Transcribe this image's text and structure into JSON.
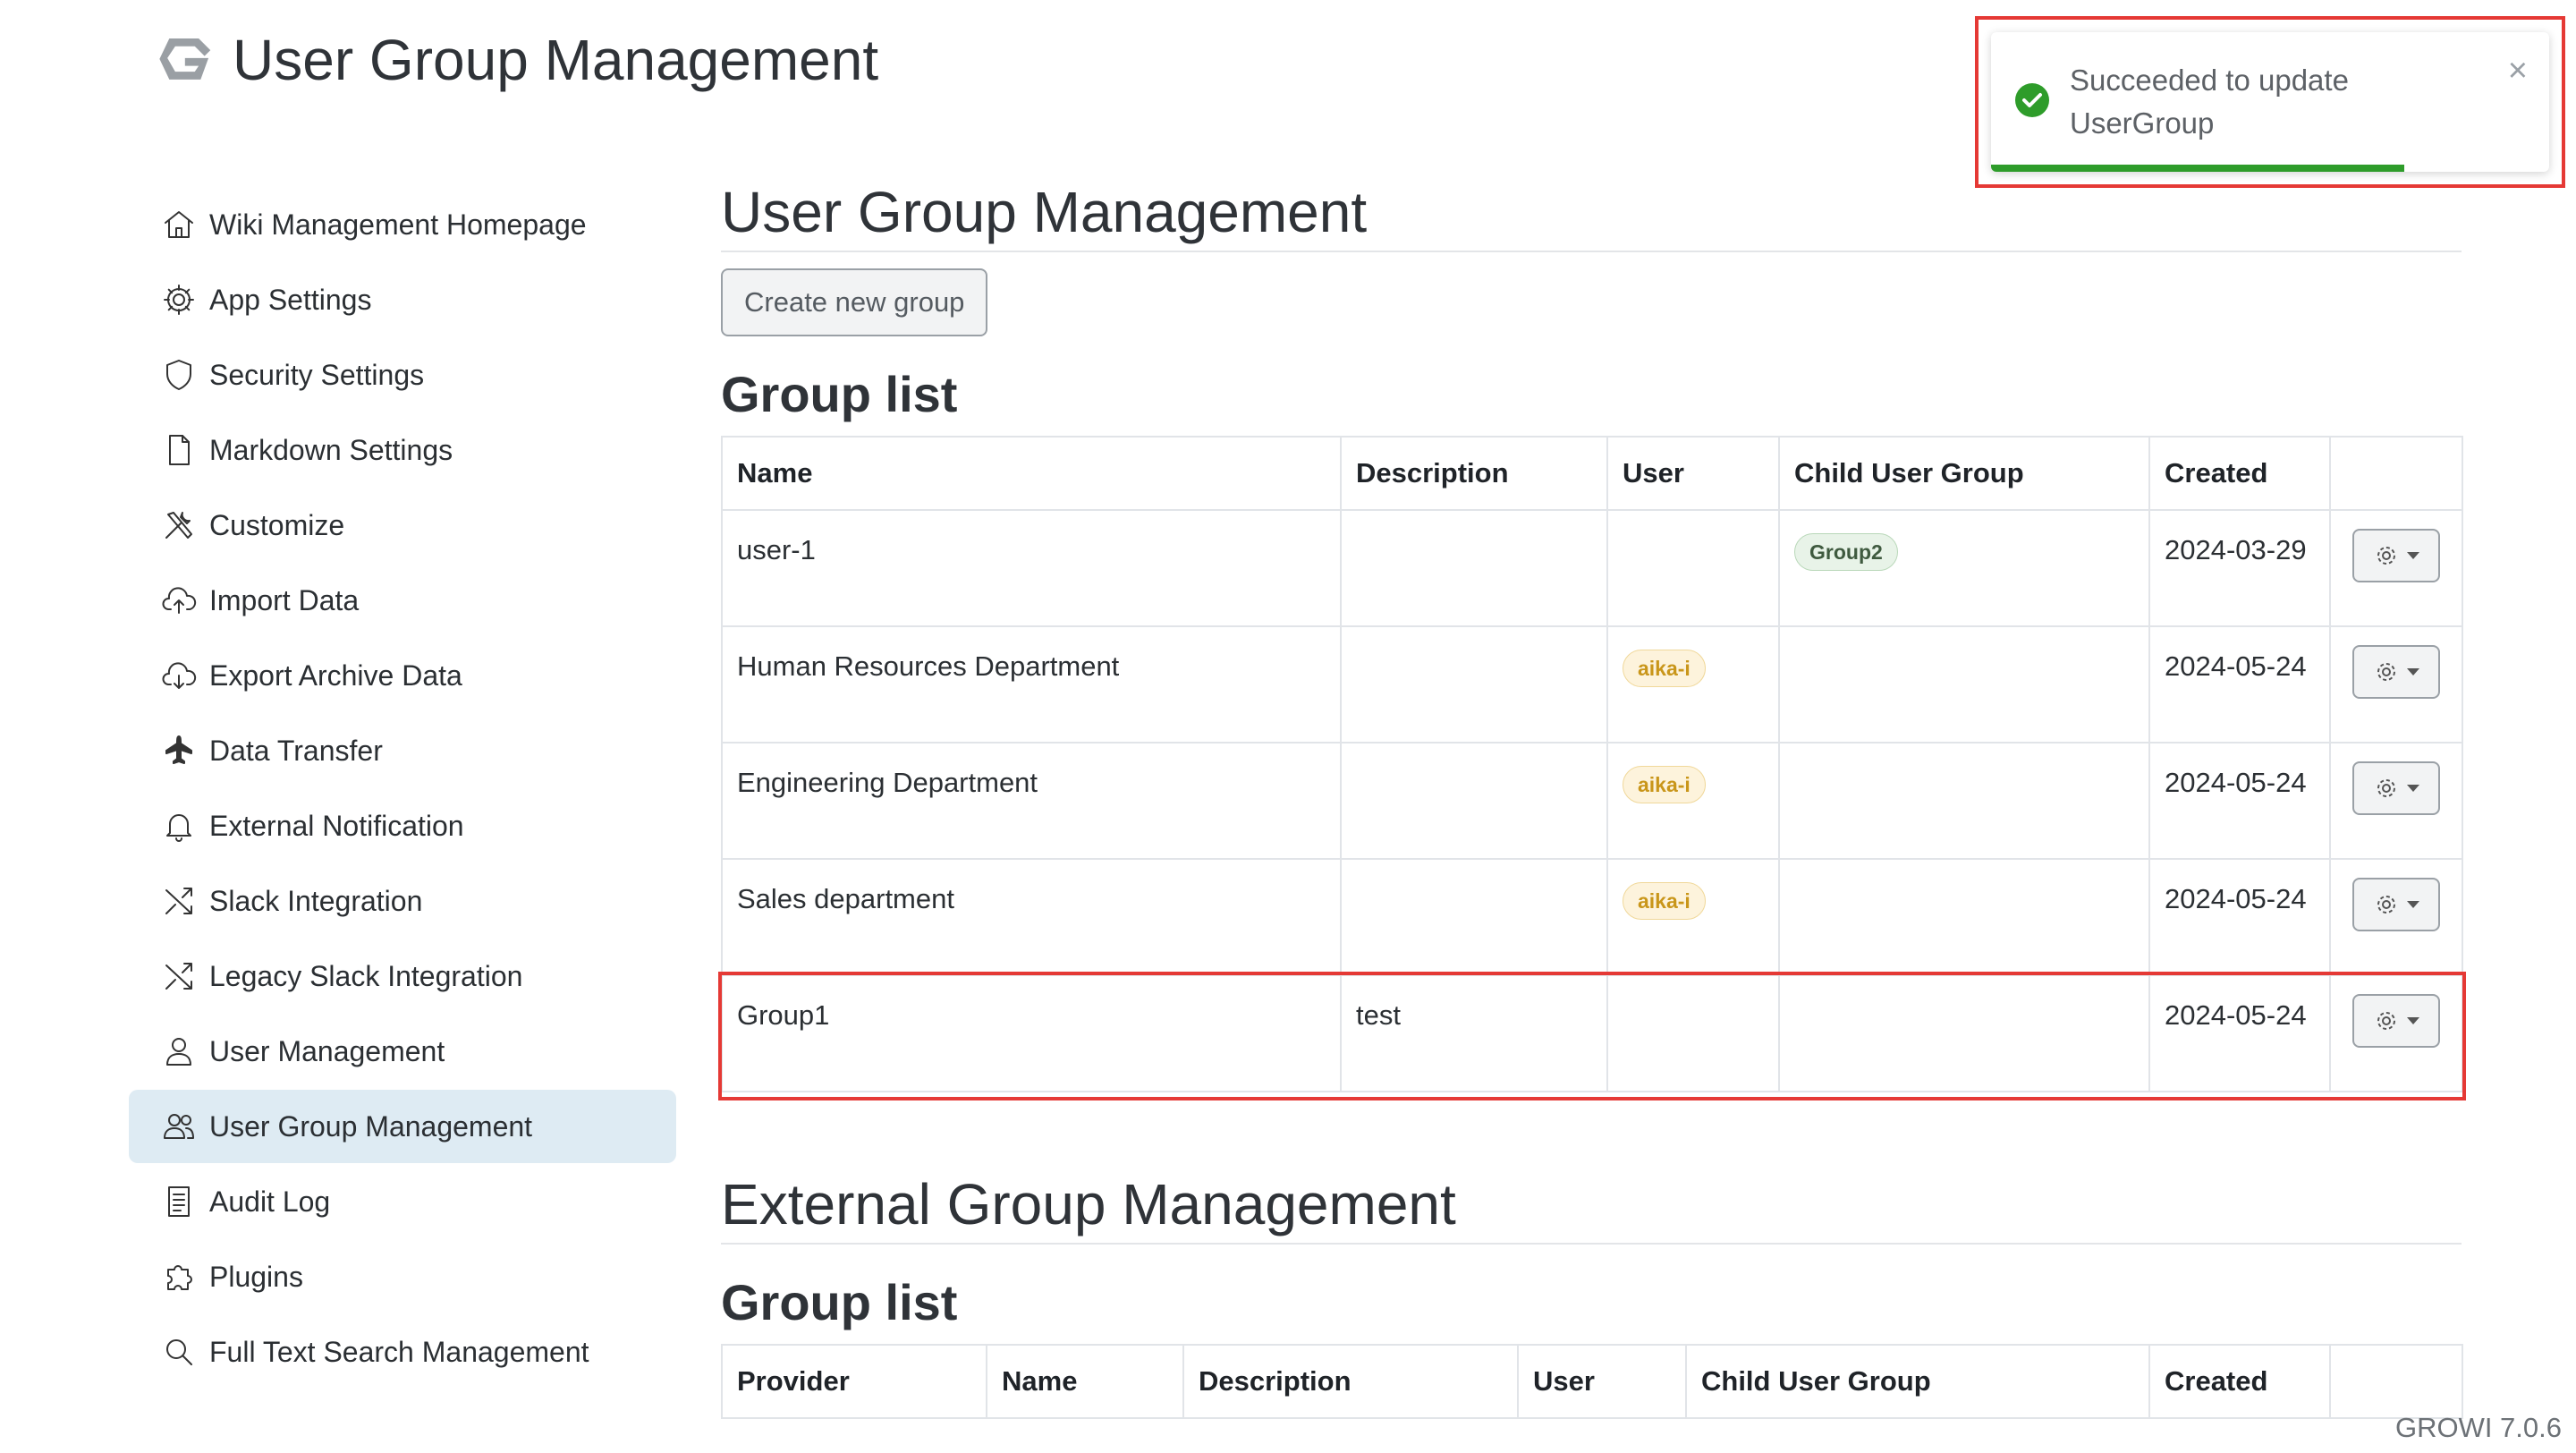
{
  "header": {
    "title": "User Group Management"
  },
  "sidebar": {
    "items": [
      {
        "label": "Wiki Management Homepage",
        "icon": "home-icon"
      },
      {
        "label": "App Settings",
        "icon": "gear-icon"
      },
      {
        "label": "Security Settings",
        "icon": "shield-icon"
      },
      {
        "label": "Markdown Settings",
        "icon": "file-icon"
      },
      {
        "label": "Customize",
        "icon": "tools-icon"
      },
      {
        "label": "Import Data",
        "icon": "cloud-upload-icon"
      },
      {
        "label": "Export Archive Data",
        "icon": "cloud-download-icon"
      },
      {
        "label": "Data Transfer",
        "icon": "airplane-icon"
      },
      {
        "label": "External Notification",
        "icon": "bell-icon"
      },
      {
        "label": "Slack Integration",
        "icon": "shuffle-icon"
      },
      {
        "label": "Legacy Slack Integration",
        "icon": "shuffle-icon"
      },
      {
        "label": "User Management",
        "icon": "user-icon"
      },
      {
        "label": "User Group Management",
        "icon": "users-icon"
      },
      {
        "label": "Audit Log",
        "icon": "document-icon"
      },
      {
        "label": "Plugins",
        "icon": "puzzle-icon"
      },
      {
        "label": "Full Text Search Management",
        "icon": "search-icon"
      }
    ],
    "active_index": 12
  },
  "main": {
    "section_title": "User Group Management",
    "create_button": "Create new group",
    "group_list_title": "Group list",
    "columns": [
      "Name",
      "Description",
      "User",
      "Child User Group",
      "Created"
    ],
    "rows": [
      {
        "name": "user-1",
        "description": "",
        "user": "",
        "child": "Group2",
        "created": "2024-03-29"
      },
      {
        "name": "Human Resources Department",
        "description": "",
        "user": "aika-i",
        "child": "",
        "created": "2024-05-24"
      },
      {
        "name": "Engineering Department",
        "description": "",
        "user": "aika-i",
        "child": "",
        "created": "2024-05-24"
      },
      {
        "name": "Sales department",
        "description": "",
        "user": "aika-i",
        "child": "",
        "created": "2024-05-24"
      },
      {
        "name": "Group1",
        "description": "test",
        "user": "",
        "child": "",
        "created": "2024-05-24"
      }
    ],
    "highlighted_row_index": 4,
    "external_section_title": "External Group Management",
    "external_group_list_title": "Group list",
    "external_columns": [
      "Provider",
      "Name",
      "Description",
      "User",
      "Child User Group",
      "Created"
    ]
  },
  "toast": {
    "message": "Succeeded to update UserGroup",
    "close_glyph": "×",
    "progress_fraction": 0.74,
    "color": "#2e9c2a"
  },
  "footer": {
    "version": "GROWI 7.0.6"
  },
  "colors": {
    "highlight": "#e53935",
    "active_nav_bg": "#deebf3"
  }
}
